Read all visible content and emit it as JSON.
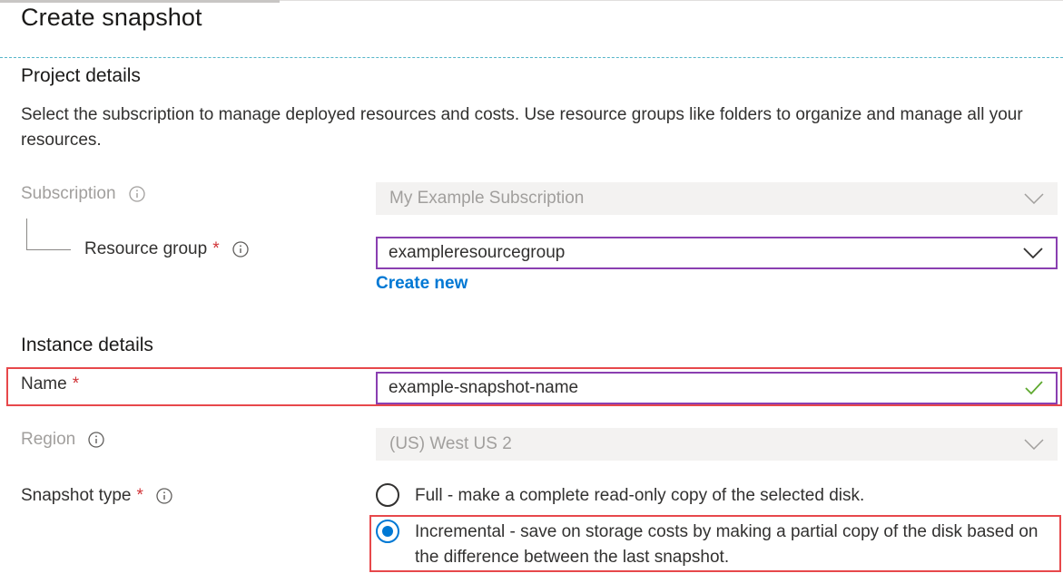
{
  "page": {
    "title": "Create snapshot"
  },
  "project": {
    "heading": "Project details",
    "description": "Select the subscription to manage deployed resources and costs. Use resource groups like folders to organize and manage all your resources.",
    "subscription": {
      "label": "Subscription",
      "value": "My Example Subscription",
      "disabled": true
    },
    "resource_group": {
      "label": "Resource group",
      "required_mark": "*",
      "value": "exampleresourcegroup",
      "create_new": "Create new"
    }
  },
  "instance": {
    "heading": "Instance details",
    "name": {
      "label": "Name",
      "required_mark": "*",
      "value": "example-snapshot-name",
      "valid": true
    },
    "region": {
      "label": "Region",
      "value": "(US) West US 2",
      "disabled": true
    },
    "snapshot_type": {
      "label": "Snapshot type",
      "required_mark": "*",
      "options": [
        {
          "label": "Full - make a complete read-only copy of the selected disk.",
          "selected": false
        },
        {
          "label": "Incremental - save on storage costs by making a partial copy of the disk based on the difference between the last snapshot.",
          "selected": true
        }
      ]
    }
  },
  "colors": {
    "accent": "#0078d4",
    "focus_border": "#8a3fb1",
    "highlight": "#e7484b",
    "valid_check": "#5ea92f",
    "required": "#d13438"
  }
}
